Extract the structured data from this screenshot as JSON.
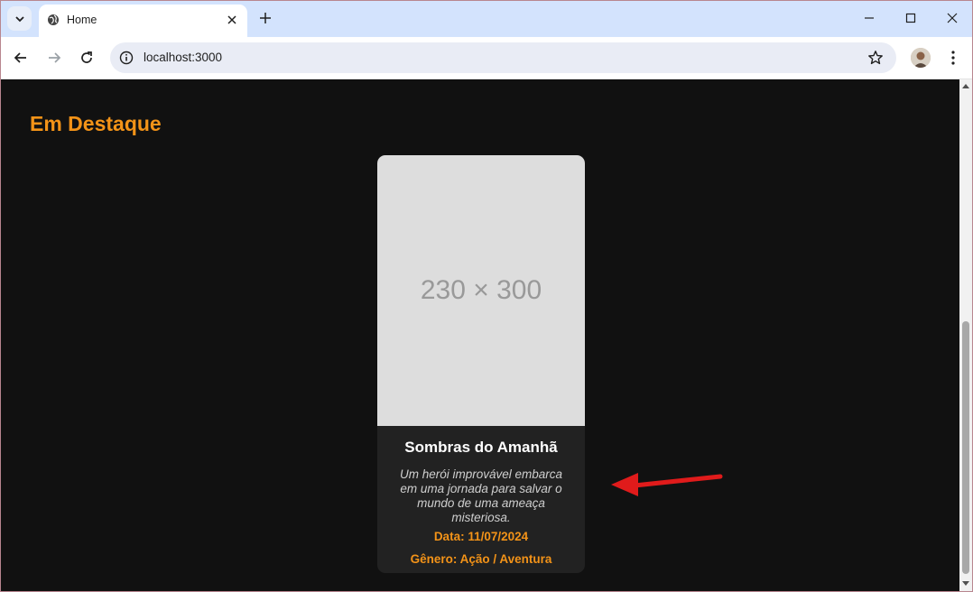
{
  "browser": {
    "tab": {
      "title": "Home"
    },
    "address_bar": {
      "url": "localhost:3000"
    }
  },
  "page": {
    "heading": "Em Destaque",
    "featured": {
      "poster_placeholder": "230 × 300",
      "title": "Sombras do Amanhã",
      "description": "Um herói improvável embarca em uma jornada para salvar o mundo de uma ameaça misteriosa.",
      "date_label": "Data:",
      "date_value": "11/07/2024",
      "genre_label": "Gênero:",
      "genre_value": "Ação / Aventura"
    }
  },
  "colors": {
    "accent": "#f39318",
    "page_background": "#111111",
    "card_background": "#222222",
    "annotation_arrow": "#e01b1b"
  },
  "icons": [
    "tab-search-icon",
    "globe-icon",
    "close-icon",
    "plus-icon",
    "minimize-icon",
    "maximize-icon",
    "back-arrow-icon",
    "forward-arrow-icon",
    "reload-icon",
    "site-info-icon",
    "bookmark-star-icon",
    "kebab-menu-icon",
    "scroll-up-icon",
    "scroll-down-icon"
  ]
}
